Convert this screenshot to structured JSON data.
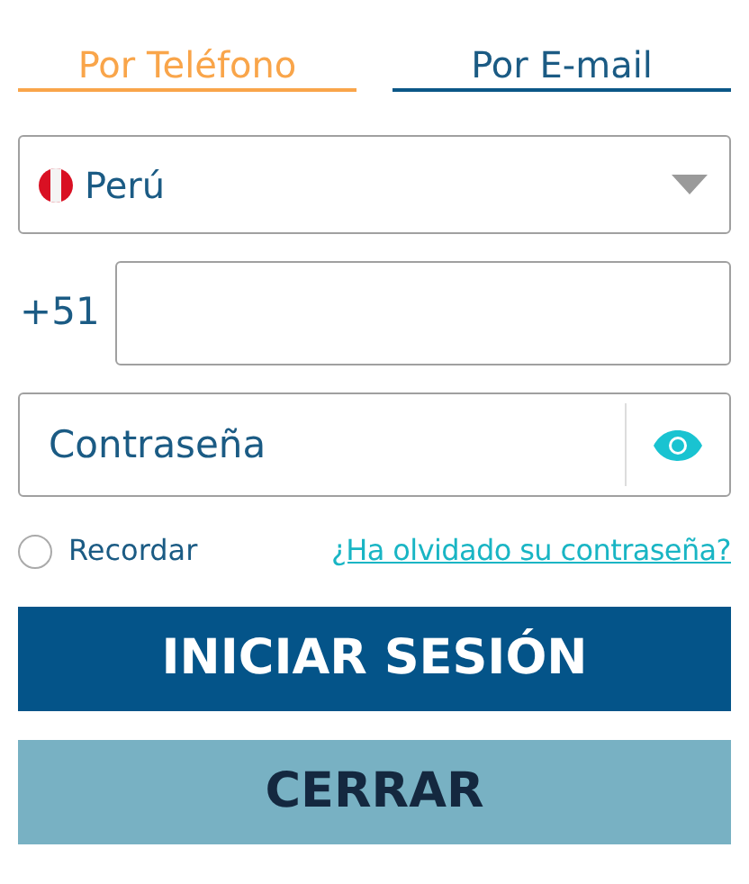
{
  "tabs": [
    {
      "label": "Por Teléfono",
      "selected": true
    },
    {
      "label": "Por E-mail",
      "selected": false
    }
  ],
  "country_select": {
    "value": "Perú"
  },
  "phone": {
    "prefix": "+51"
  },
  "password": {
    "placeholder": "Contraseña"
  },
  "remember": {
    "label": "Recordar",
    "checked": false
  },
  "forgot_link": "¿Ha olvidado su contraseña?",
  "buttons": [
    {
      "label": "INICIAR SESIÓN",
      "kind": "primary"
    },
    {
      "label": "CERRAR",
      "kind": "secondary"
    }
  ]
}
